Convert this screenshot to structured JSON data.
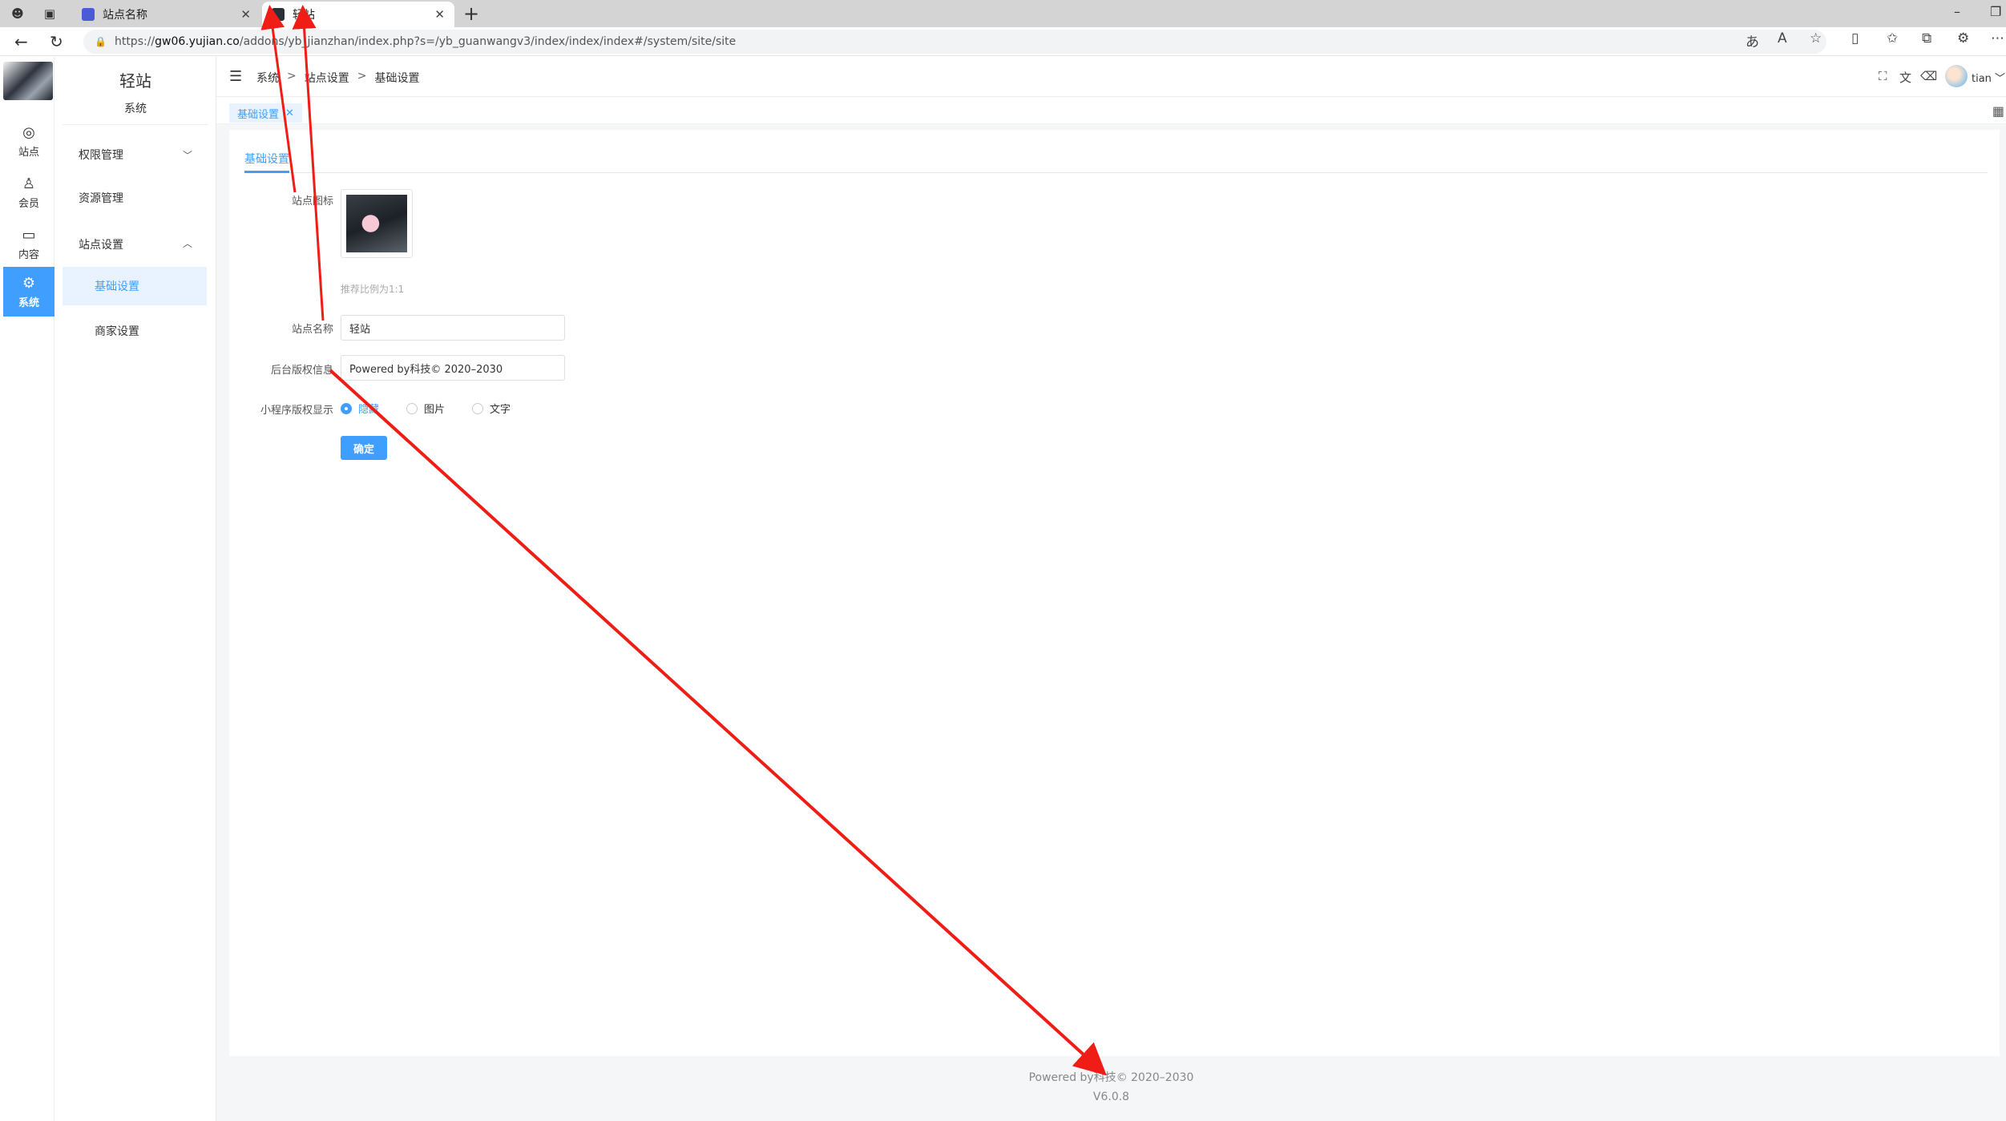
{
  "browser": {
    "tabs": [
      {
        "title": "站点名称",
        "favicon_color": "#4b5bd6"
      },
      {
        "title": "轻站",
        "favicon_color": "#2a2f38"
      }
    ],
    "url_prefix": "https://",
    "url_host": "gw06.yujian.co",
    "url_path": "/addons/yb_jianzhan/index.php?s=/yb_guanwangv3/index/index/index#/system/site/site"
  },
  "rail": {
    "items": [
      {
        "label": "站点",
        "icon": "globe-icon"
      },
      {
        "label": "会员",
        "icon": "user-icon"
      },
      {
        "label": "内容",
        "icon": "folder-icon"
      },
      {
        "label": "系统",
        "icon": "gear-icon",
        "active": true
      }
    ]
  },
  "sidenav": {
    "title": "轻站",
    "subtitle": "系统",
    "groups": [
      {
        "label": "权限管理"
      },
      {
        "label": "资源管理"
      },
      {
        "label": "站点设置"
      }
    ],
    "children": [
      {
        "label": "基础设置",
        "active": true
      },
      {
        "label": "商家设置"
      }
    ]
  },
  "topbar": {
    "breadcrumb": [
      "系统",
      "站点设置",
      "基础设置"
    ],
    "username": "tian"
  },
  "tags": {
    "active": "基础设置"
  },
  "form": {
    "tab": "基础设置",
    "icon_label": "站点图标",
    "icon_hint": "推荐比例为1:1",
    "name_label": "站点名称",
    "name_value": "轻站",
    "copyright_label": "后台版权信息",
    "copyright_value": "Powered by科技© 2020–2030",
    "mini_label": "小程序版权显示",
    "mini_options": [
      "隐藏",
      "图片",
      "文字"
    ],
    "mini_selected": "隐藏",
    "submit": "确定"
  },
  "footer": {
    "copyright": "Powered by科技© 2020–2030",
    "version": "V6.0.8"
  },
  "colors": {
    "accent": "#409eff",
    "annotation_arrow": "#f01c16"
  }
}
